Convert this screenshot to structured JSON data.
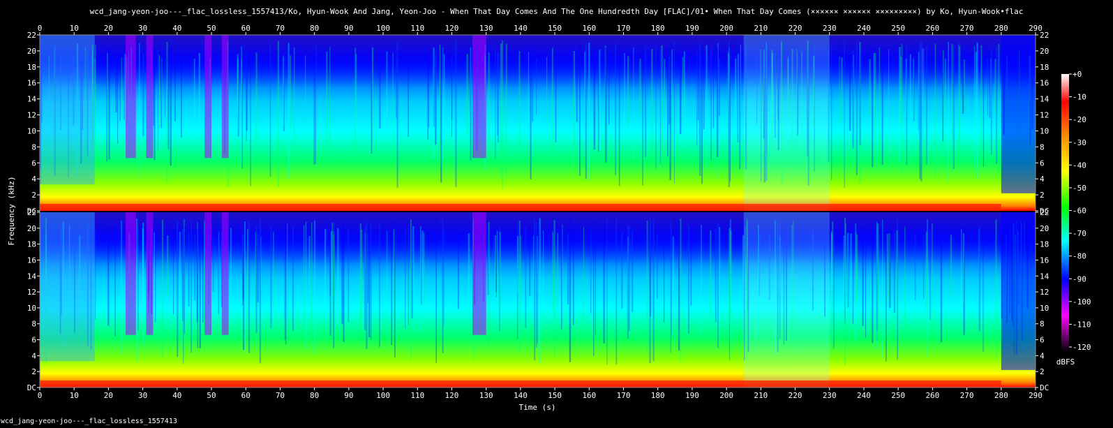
{
  "title": "wcd_jang-yeon-joo---_flac_lossless_1557413/Ko, Hyun-Wook And Jang, Yeon-Joo - When That Day Comes And The One Hundredth Day [FLAC]/01• When That Day Comes (×××××× ×××××× ×××××××××) by Ko, Hyun-Wook•flac",
  "footer": "wcd_jang-yeon-joo---_flac_lossless_1557413",
  "chart_data": {
    "type": "heatmap",
    "title": "wcd_jang-yeon-joo---_flac_lossless_1557413/Ko, Hyun-Wook And Jang, Yeon-Joo - When That Day Comes And The One Hundredth Day [FLAC]/01• When That Day Comes (×××××× ×××××× ×××××××××) by Ko, Hyun-Wook•flac",
    "xlabel": "Time (s)",
    "ylabel": "Frequency (kHz)",
    "xlim": [
      0,
      290
    ],
    "x_ticks": [
      0,
      10,
      20,
      30,
      40,
      50,
      60,
      70,
      80,
      90,
      100,
      110,
      120,
      130,
      140,
      150,
      160,
      170,
      180,
      190,
      200,
      210,
      220,
      230,
      240,
      250,
      260,
      270,
      280,
      290
    ],
    "ylim": [
      0,
      22
    ],
    "y_tick_labels": [
      "DC",
      "2",
      "4",
      "6",
      "8",
      "10",
      "12",
      "14",
      "16",
      "18",
      "20",
      "22"
    ],
    "channels": 2,
    "colorbar": {
      "label": "dBFS",
      "range": [
        -120,
        0
      ],
      "tick_labels": [
        "+0",
        "-10",
        "-20",
        "-30",
        "-40",
        "-50",
        "-60",
        "-70",
        "-80",
        "-90",
        "-100",
        "-110",
        "-120"
      ],
      "colors": [
        "#ffffff",
        "#ff0000",
        "#ffff00",
        "#00ff00",
        "#00ffff",
        "#0000ff",
        "#ff00ff",
        "#000000"
      ]
    },
    "quiet_segments_s": [
      [
        0,
        16
      ],
      [
        25,
        28
      ],
      [
        31,
        33
      ],
      [
        48,
        50
      ],
      [
        53,
        55
      ],
      [
        126,
        130
      ],
      [
        280,
        290
      ]
    ],
    "dense_segments_s": [
      [
        205,
        230
      ]
    ]
  }
}
